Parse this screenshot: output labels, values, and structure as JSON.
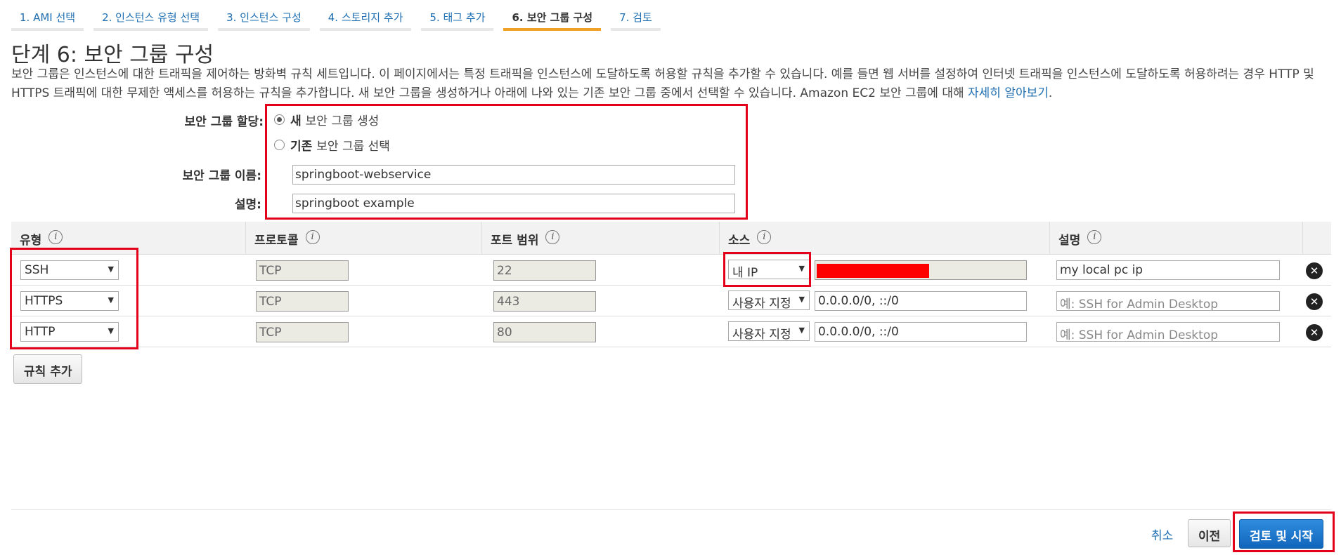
{
  "steps": [
    {
      "label": "1. AMI 선택"
    },
    {
      "label": "2. 인스턴스 유형 선택"
    },
    {
      "label": "3. 인스턴스 구성"
    },
    {
      "label": "4. 스토리지 추가"
    },
    {
      "label": "5. 태그 추가"
    },
    {
      "label": "6. 보안 그룹 구성"
    },
    {
      "label": "7. 검토"
    }
  ],
  "page_title": "단계 6: 보안 그룹 구성",
  "intro": {
    "text": "보안 그룹은 인스턴스에 대한 트래픽을 제어하는 방화벽 규칙 세트입니다. 이 페이지에서는 특정 트래픽을 인스턴스에 도달하도록 허용할 규칙을 추가할 수 있습니다. 예를 들면 웹 서버를 설정하여 인터넷 트래픽을 인스턴스에 도달하도록 허용하려는 경우 HTTP 및 HTTPS 트래픽에 대한 무제한 액세스를 허용하는 규칙을 추가합니다. 새 보안 그룹을 생성하거나 아래에 나와 있는 기존 보안 그룹 중에서 선택할 수 있습니다. Amazon EC2 보안 그룹에 대해 ",
    "link": "자세히 알아보기",
    "trailing": "."
  },
  "assignment": {
    "label": "보안 그룹 할당:",
    "option_new_bold": "새",
    "option_new_rest": "보안 그룹 생성",
    "option_existing_bold": "기존",
    "option_existing_rest": "보안 그룹 선택",
    "selected": "new"
  },
  "group_name": {
    "label": "보안 그룹 이름:",
    "value": "springboot-webservice"
  },
  "description": {
    "label": "설명:",
    "value": "springboot example"
  },
  "table": {
    "headers": [
      "유형",
      "프로토콜",
      "포트 범위",
      "소스",
      "설명"
    ],
    "info_icon": "i",
    "rows": [
      {
        "type": "SSH",
        "protocol": "TCP",
        "port": "22",
        "source": "내 IP",
        "cidr": "",
        "desc": "my local pc ip",
        "desc_placeholder": false
      },
      {
        "type": "HTTPS",
        "protocol": "TCP",
        "port": "443",
        "source": "사용자 지정",
        "cidr": "0.0.0.0/0, ::/0",
        "desc": "예: SSH for Admin Desktop",
        "desc_placeholder": true
      },
      {
        "type": "HTTP",
        "protocol": "TCP",
        "port": "80",
        "source": "사용자 지정",
        "cidr": "0.0.0.0/0, ::/0",
        "desc": "예: SSH for Admin Desktop",
        "desc_placeholder": true
      }
    ],
    "remove_glyph": "✕"
  },
  "add_rule": "규칙 추가",
  "footer": {
    "cancel": "취소",
    "previous": "이전",
    "review_launch": "검토 및 시작"
  },
  "colors": {
    "accent": "#f0a12a",
    "link": "#1f6fb2",
    "highlight": "#e3001b",
    "primary": "#1166bb"
  }
}
